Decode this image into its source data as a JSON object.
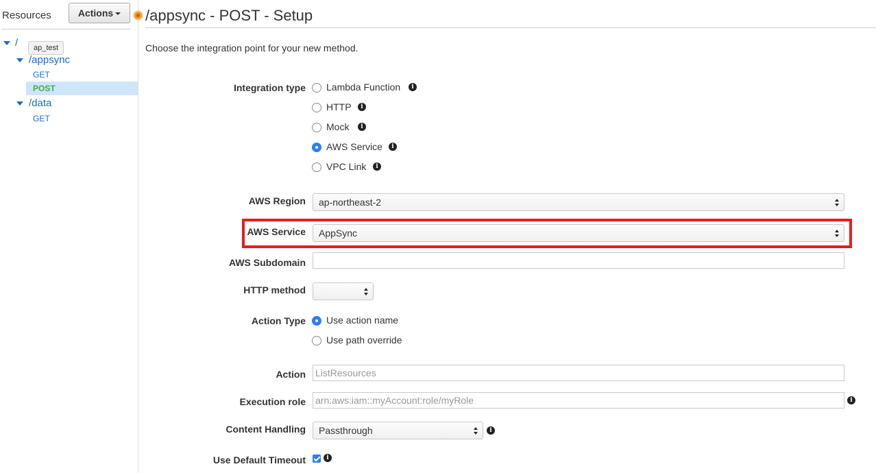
{
  "sidebar": {
    "title": "Resources",
    "actions_label": "Actions",
    "tooltip": "ap_test",
    "tree": {
      "root": "/",
      "appsync": "/appsync",
      "appsync_get": "GET",
      "appsync_post": "POST",
      "data": "/data",
      "data_get": "GET"
    }
  },
  "header": {
    "title": "/appsync - POST - Setup"
  },
  "main": {
    "intro": "Choose the integration point for your new method.",
    "integration_type": {
      "label": "Integration type",
      "options": [
        "Lambda Function",
        "HTTP",
        "Mock",
        "AWS Service",
        "VPC Link"
      ],
      "selected": "AWS Service"
    },
    "aws_region": {
      "label": "AWS Region",
      "value": "ap-northeast-2"
    },
    "aws_service": {
      "label": "AWS Service",
      "value": "AppSync"
    },
    "aws_subdomain": {
      "label": "AWS Subdomain",
      "value": ""
    },
    "http_method": {
      "label": "HTTP method",
      "value": ""
    },
    "action_type": {
      "label": "Action Type",
      "options": [
        "Use action name",
        "Use path override"
      ],
      "selected": "Use action name"
    },
    "action": {
      "label": "Action",
      "placeholder": "ListResources"
    },
    "execution_role": {
      "label": "Execution role",
      "placeholder": "arn:aws:iam::myAccount:role/myRole"
    },
    "content_handling": {
      "label": "Content Handling",
      "value": "Passthrough"
    },
    "default_timeout": {
      "label": "Use Default Timeout",
      "checked": true
    }
  },
  "colors": {
    "link_blue": "#1a6bc4",
    "post_green": "#3fae4a",
    "radio_blue": "#2d7ff0",
    "highlight_red": "#e41e1e",
    "selected_row": "#cfe5fb"
  }
}
